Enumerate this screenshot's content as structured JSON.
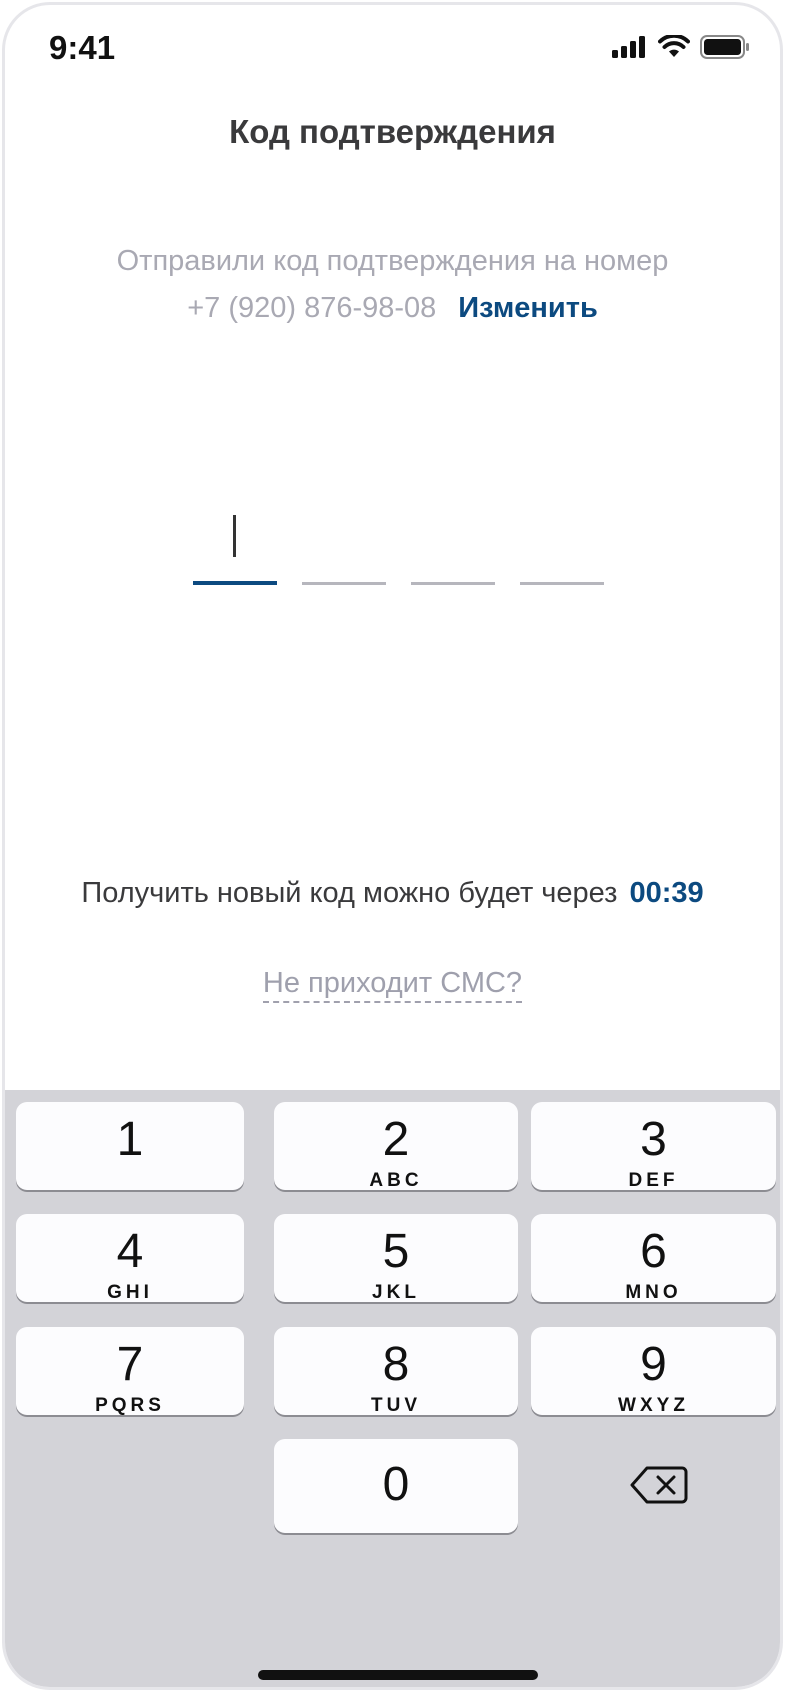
{
  "status_bar": {
    "time": "9:41"
  },
  "header": {
    "title": "Код подтверждения"
  },
  "info": {
    "sent_text": "Отправили код подтверждения на номер",
    "phone": "+7 (920) 876-98-08",
    "change_label": "Изменить"
  },
  "code": {
    "length": 4,
    "active_index": 0
  },
  "resend": {
    "text": "Получить новый код можно будет через",
    "timer": "00:39"
  },
  "help": {
    "no_sms_label": "Не приходит СМС?"
  },
  "keypad": {
    "keys": [
      {
        "digit": "1",
        "letters": ""
      },
      {
        "digit": "2",
        "letters": "ABC"
      },
      {
        "digit": "3",
        "letters": "DEF"
      },
      {
        "digit": "4",
        "letters": "GHI"
      },
      {
        "digit": "5",
        "letters": "JKL"
      },
      {
        "digit": "6",
        "letters": "MNO"
      },
      {
        "digit": "7",
        "letters": "PQRS"
      },
      {
        "digit": "8",
        "letters": "TUV"
      },
      {
        "digit": "9",
        "letters": "WXYZ"
      },
      {
        "digit": "0",
        "letters": ""
      }
    ],
    "delete_icon": "backspace-icon"
  },
  "colors": {
    "accent": "#0c4a80",
    "muted": "#a9a9b3",
    "keyboard_bg": "#d3d3d8"
  }
}
